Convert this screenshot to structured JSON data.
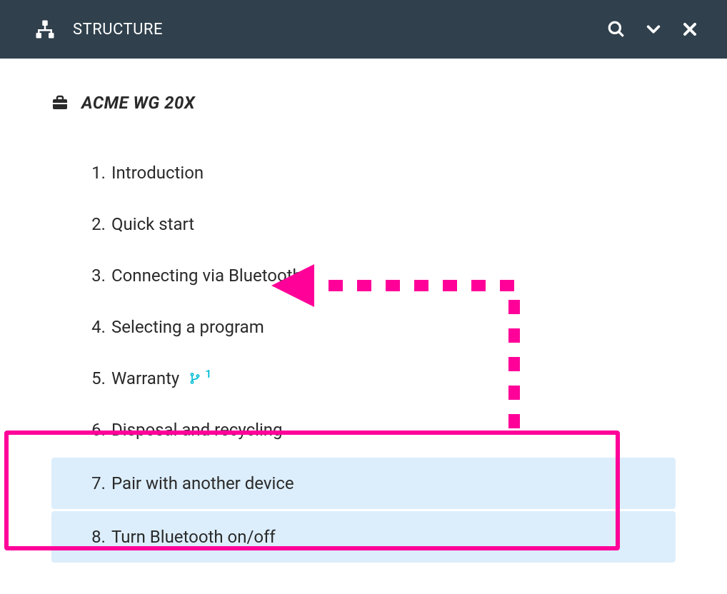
{
  "header": {
    "title": "STRUCTURE"
  },
  "project": {
    "title": "ACME WG 20X"
  },
  "toc": [
    {
      "num": "1.",
      "label": "Introduction",
      "selected": false,
      "branch": null
    },
    {
      "num": "2.",
      "label": "Quick start",
      "selected": false,
      "branch": null
    },
    {
      "num": "3.",
      "label": "Connecting via Bluetooth",
      "selected": false,
      "branch": null
    },
    {
      "num": "4.",
      "label": "Selecting a program",
      "selected": false,
      "branch": null
    },
    {
      "num": "5.",
      "label": "Warranty",
      "selected": false,
      "branch": "1"
    },
    {
      "num": "6.",
      "label": "Disposal and recycling",
      "selected": false,
      "branch": null
    },
    {
      "num": "7.",
      "label": "Pair with another device",
      "selected": true,
      "branch": null
    },
    {
      "num": "8.",
      "label": "Turn Bluetooth on/off",
      "selected": true,
      "branch": null
    }
  ],
  "annotation": {
    "arrow_color": "#ff0099",
    "selection_color": "#ff0099"
  }
}
